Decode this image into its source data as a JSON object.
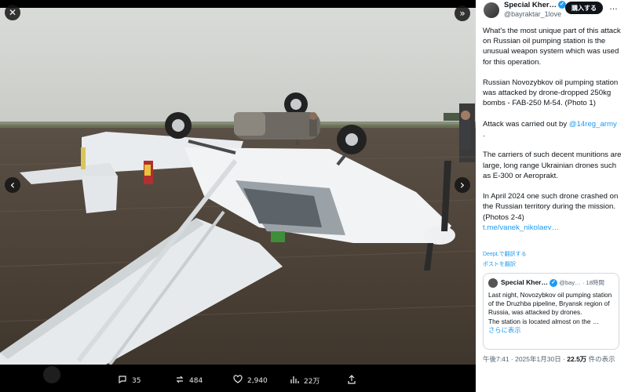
{
  "viewer": {
    "close_glyph": "✕",
    "collapse_glyph": "»",
    "prev_glyph": "‹",
    "next_glyph": "›"
  },
  "actions": {
    "replies": "35",
    "reposts": "484",
    "likes": "2,940",
    "views": "22万"
  },
  "tweet": {
    "display_name": "Special Kher…",
    "handle": "@bayraktar_1love",
    "subscribe_label": "購入する",
    "more_glyph": "…",
    "paragraphs": [
      "What's the most unique part of this attack on Russian oil pumping station is the unusual weapon system which was used for this operation.",
      "Russian Novozybkov oil pumping station was attacked by drone-dropped 250kg bombs - FAB-250 M-54. (Photo 1)",
      "The carriers of such decent munitions are large, long range Ukrainian drones such as E-300 or Aeroprakt.",
      "In April 2024 one such drone crashed on the Russian territory during the mission. (Photos 2-4)"
    ],
    "attack_prefix": "Attack was carried out by ",
    "attack_mention": "@14reg_army",
    "attack_suffix": ".",
    "link": "t.me/vanek_nikolaev…",
    "translate_note": "DeepLで翻訳する",
    "translate_link": "ポストを翻訳",
    "quote": {
      "name": "Special Kher…",
      "handle": "@bay…",
      "time": "· 18時間",
      "text": "Last night, Novozybkov oil pumping station of the Druzhba pipeline, Bryansk region of Russia, was attacked by drones.",
      "text2": "The station is located almost on the …",
      "more": "さらに表示"
    },
    "timestamp": "午後7:41 · 2025年1月30日 · ",
    "views_count": "22.5万",
    "views_label": " 件の表示"
  },
  "colors": {
    "accent": "#1d9bf0",
    "text": "#0f1419",
    "muted": "#536471"
  }
}
